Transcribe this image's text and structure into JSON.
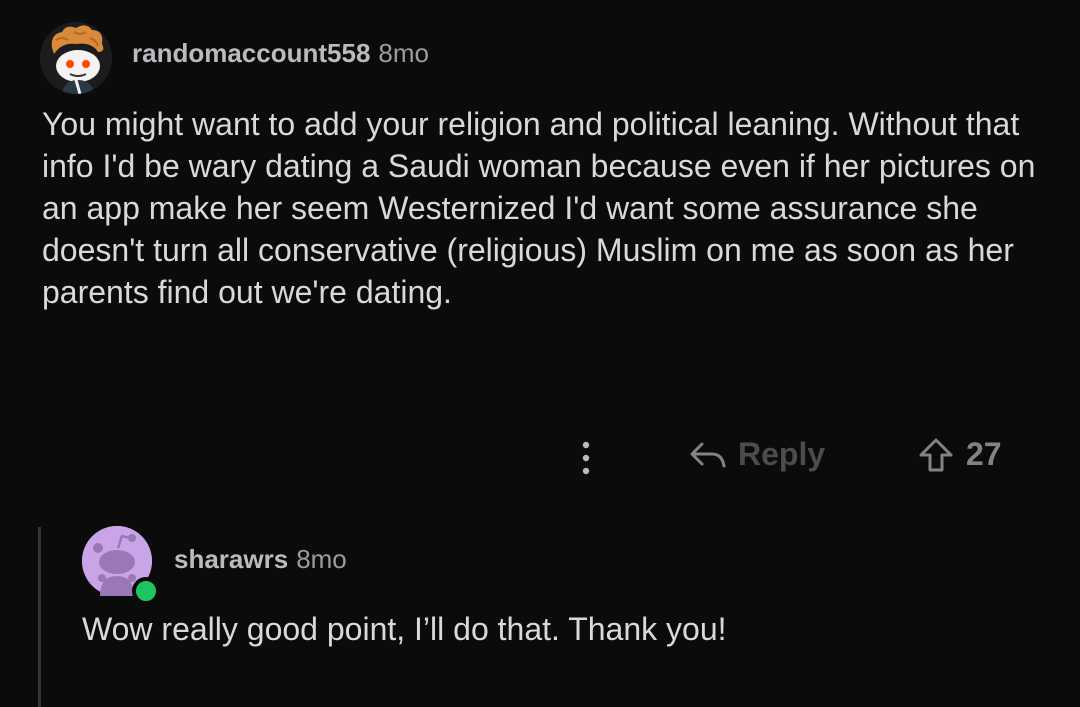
{
  "comment": {
    "username": "randomaccount558",
    "age": "8mo",
    "body": "You might want to add your religion and political leaning. Without that info I'd be wary dating a Saudi woman because even if her pictures on an app make her seem Westernized I'd want some assurance she doesn't turn all conservative (religious) Muslim on me as soon as her parents find out we're dating.",
    "actions": {
      "reply_label": "Reply",
      "vote_count": "27"
    }
  },
  "reply": {
    "username": "sharawrs",
    "age": "8mo",
    "body": "Wow really good point, I’ll do that. Thank you!",
    "online": true
  },
  "colors": {
    "background": "#0b0b0c",
    "text": "#d7dadc",
    "username": "#b9bcbe",
    "muted": "#818384",
    "online_dot": "#1ec55f",
    "avatar2_bg": "#c9a4e6"
  },
  "icons": {
    "more": "vertical-dots-icon",
    "reply": "reply-arrow-icon",
    "upvote": "upvote-arrow-icon"
  }
}
